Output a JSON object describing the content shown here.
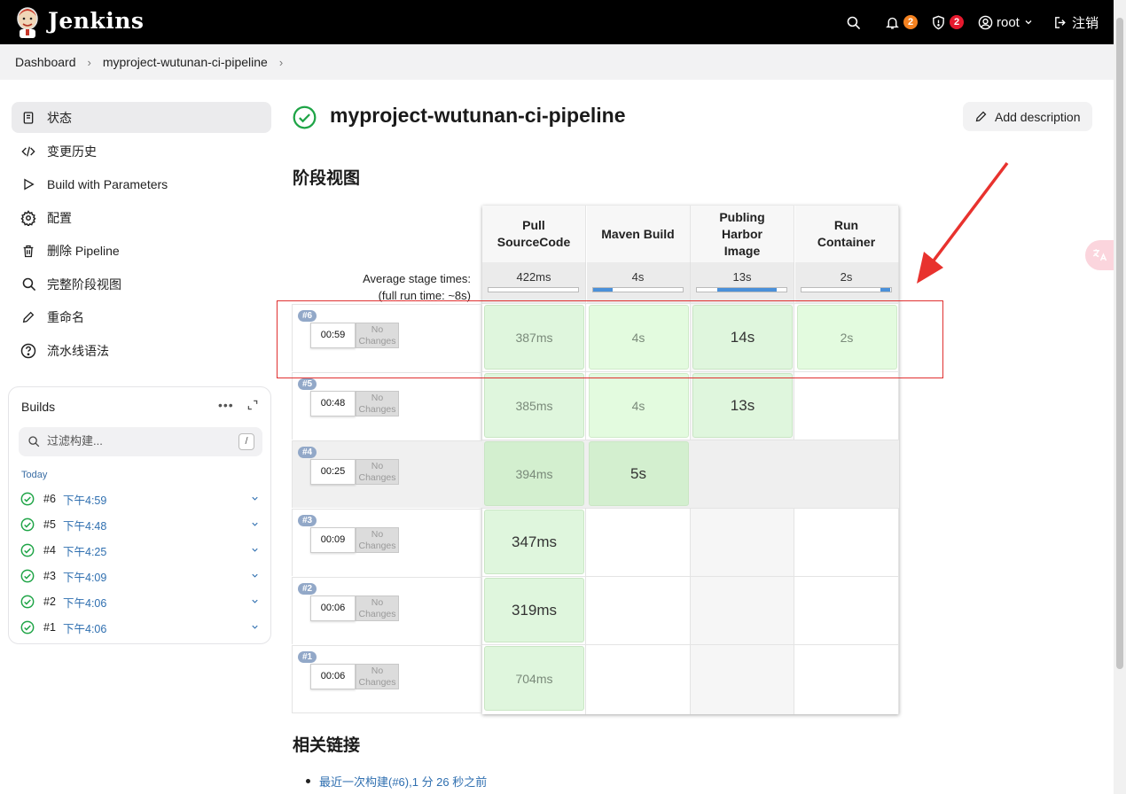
{
  "header": {
    "brand": "Jenkins",
    "notifications_count": "2",
    "security_count": "2",
    "user": "root",
    "logout": "注销"
  },
  "breadcrumb": [
    "Dashboard",
    "myproject-wutunan-ci-pipeline"
  ],
  "sidebar": {
    "items": [
      {
        "label": "状态",
        "icon": "document-icon"
      },
      {
        "label": "变更历史",
        "icon": "code-icon"
      },
      {
        "label": "Build with Parameters",
        "icon": "play-icon"
      },
      {
        "label": "配置",
        "icon": "gear-icon"
      },
      {
        "label": "删除 Pipeline",
        "icon": "trash-icon"
      },
      {
        "label": "完整阶段视图",
        "icon": "search-icon"
      },
      {
        "label": "重命名",
        "icon": "pencil-icon"
      },
      {
        "label": "流水线语法",
        "icon": "help-icon"
      }
    ]
  },
  "builds_panel": {
    "title": "Builds",
    "more": "•••",
    "filter_placeholder": "过滤构建...",
    "filter_key": "/",
    "group": "Today",
    "builds": [
      {
        "num": "#6",
        "time": "下午4:59"
      },
      {
        "num": "#5",
        "time": "下午4:48"
      },
      {
        "num": "#4",
        "time": "下午4:25"
      },
      {
        "num": "#3",
        "time": "下午4:09"
      },
      {
        "num": "#2",
        "time": "下午4:06"
      },
      {
        "num": "#1",
        "time": "下午4:06"
      }
    ]
  },
  "main": {
    "title": "myproject-wutunan-ci-pipeline",
    "add_description": "Add description",
    "stage_view_title": "阶段视图",
    "related_links_title": "相关链接",
    "links": [
      "最近一次构建(#6),1 分 26 秒之前"
    ]
  },
  "stage_view": {
    "avg_label": "Average stage times:",
    "full_run_prefix": "(",
    "full_run_word": "full",
    "full_run_rest": " run time: ~8s)",
    "stages": [
      {
        "name": "Pull SourceCode",
        "avg": "422ms",
        "avg_fill_start": 0.0,
        "avg_fill": 0.0
      },
      {
        "name": "Maven Build",
        "avg": "4s",
        "avg_fill_start": 0.0,
        "avg_fill": 0.22
      },
      {
        "name": "Publing Harbor Image",
        "avg": "13s",
        "avg_fill_start": 0.23,
        "avg_fill": 0.66
      },
      {
        "name": "Run Container",
        "avg": "2s",
        "avg_fill_start": 0.89,
        "avg_fill": 0.11
      }
    ],
    "runs": [
      {
        "num": "#6",
        "time": "00:59",
        "changes": "No Changes",
        "cells": [
          "387ms",
          "4s",
          "14s",
          "2s"
        ]
      },
      {
        "num": "#5",
        "time": "00:48",
        "changes": "No Changes",
        "cells": [
          "385ms",
          "4s",
          "13s",
          ""
        ]
      },
      {
        "num": "#4",
        "time": "00:25",
        "changes": "No Changes",
        "cells": [
          "394ms",
          "5s",
          "",
          ""
        ]
      },
      {
        "num": "#3",
        "time": "00:09",
        "changes": "No Changes",
        "cells": [
          "347ms",
          "",
          "",
          ""
        ]
      },
      {
        "num": "#2",
        "time": "00:06",
        "changes": "No Changes",
        "cells": [
          "319ms",
          "",
          "",
          ""
        ]
      },
      {
        "num": "#1",
        "time": "00:06",
        "changes": "No Changes",
        "cells": [
          "704ms",
          "",
          "",
          ""
        ]
      }
    ]
  },
  "colors": {
    "success": "#1ea446",
    "cell_green": "#dff6dd",
    "badge_orange": "#f58220",
    "badge_red": "#e6192e",
    "annotation_red": "#e03030"
  }
}
